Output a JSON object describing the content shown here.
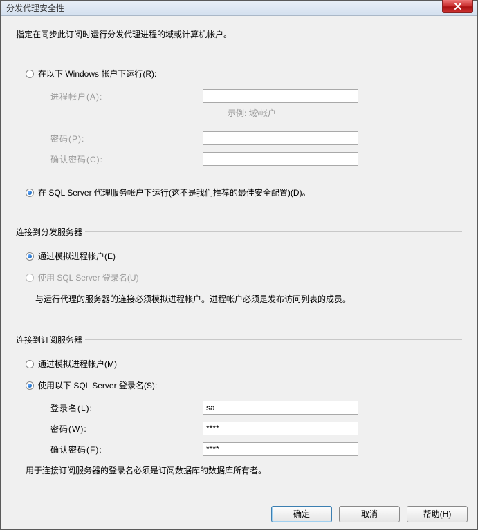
{
  "title": "分发代理安全性",
  "instruction": "指定在同步此订阅时运行分发代理进程的域或计算机帐户。",
  "run_as": {
    "windows_label": "在以下 Windows 帐户下运行(R):",
    "process_account_label": "进程帐户(A):",
    "example": "示例: 域\\帐户",
    "password_label": "密码(P):",
    "confirm_password_label": "确认密码(C):",
    "sql_agent_label": "在 SQL Server 代理服务帐户下运行(这不是我们推荐的最佳安全配置)(D)。"
  },
  "distributor": {
    "title": "连接到分发服务器",
    "impersonate_label": "通过模拟进程帐户(E)",
    "sql_login_label": "使用 SQL Server 登录名(U)",
    "note": "与运行代理的服务器的连接必须模拟进程帐户。进程帐户必须是发布访问列表的成员。"
  },
  "subscriber": {
    "title": "连接到订阅服务器",
    "impersonate_label": "通过模拟进程帐户(M)",
    "sql_login_label": "使用以下 SQL Server 登录名(S):",
    "login_label": "登录名(L):",
    "login_value": "sa",
    "password_label": "密码(W):",
    "password_value": "****",
    "confirm_label": "确认密码(F):",
    "confirm_value": "****",
    "note": "用于连接订阅服务器的登录名必须是订阅数据库的数据库所有者。"
  },
  "buttons": {
    "ok": "确定",
    "cancel": "取消",
    "help": "帮助(H)"
  }
}
